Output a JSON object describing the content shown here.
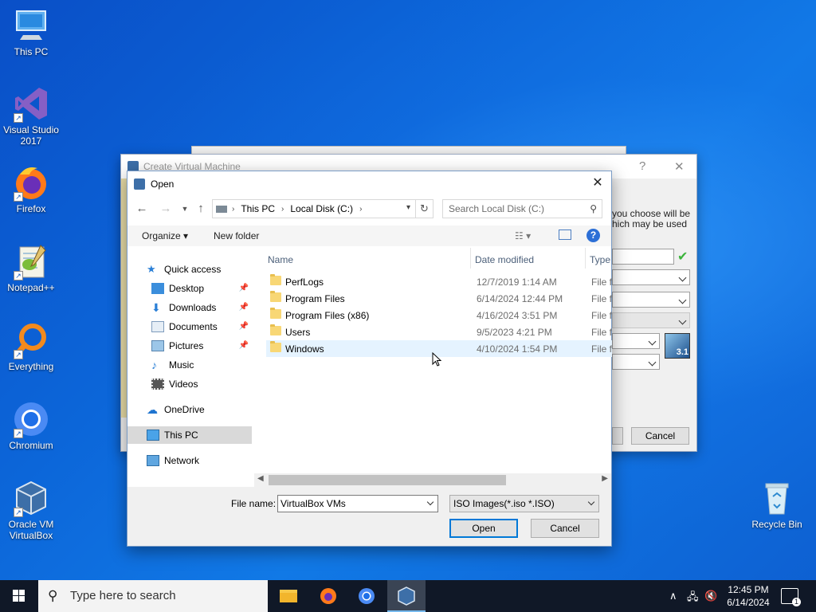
{
  "desktop": {
    "icons": [
      {
        "label": "This PC",
        "icon": "computer-icon"
      },
      {
        "label": "Visual Studio 2017",
        "icon": "visual-studio-icon"
      },
      {
        "label": "Firefox",
        "icon": "firefox-icon"
      },
      {
        "label": "Notepad++",
        "icon": "notepadpp-icon"
      },
      {
        "label": "Everything",
        "icon": "everything-icon"
      },
      {
        "label": "Chromium",
        "icon": "chromium-icon"
      },
      {
        "label": "Oracle VM VirtualBox",
        "icon": "virtualbox-icon"
      },
      {
        "label": "Recycle Bin",
        "icon": "recycle-bin-icon"
      }
    ]
  },
  "vbox_window": {
    "title": "Create Virtual Machine",
    "help_label": "?",
    "close_label": "✕",
    "side_text": "you choose will be hich may be used",
    "cancel_label": "Cancel",
    "version_badge": "3.1"
  },
  "dialog": {
    "title": "Open",
    "close_label": "✕",
    "breadcrumb": [
      "This PC",
      "Local Disk (C:)"
    ],
    "search_placeholder": "Search Local Disk (C:)",
    "toolbar": {
      "organize": "Organize",
      "new_folder": "New folder"
    },
    "nav": {
      "quick_access": "Quick access",
      "desktop": "Desktop",
      "downloads": "Downloads",
      "documents": "Documents",
      "pictures": "Pictures",
      "music": "Music",
      "videos": "Videos",
      "onedrive": "OneDrive",
      "this_pc": "This PC",
      "network": "Network"
    },
    "columns": {
      "name": "Name",
      "date": "Date modified",
      "type": "Type"
    },
    "files": [
      {
        "name": "PerfLogs",
        "date": "12/7/2019 1:14 AM",
        "type": "File fo"
      },
      {
        "name": "Program Files",
        "date": "6/14/2024 12:44 PM",
        "type": "File fo"
      },
      {
        "name": "Program Files (x86)",
        "date": "4/16/2024 3:51 PM",
        "type": "File fo"
      },
      {
        "name": "Users",
        "date": "9/5/2023 4:21 PM",
        "type": "File fo"
      },
      {
        "name": "Windows",
        "date": "4/10/2024 1:54 PM",
        "type": "File fo"
      }
    ],
    "file_name_label": "File name:",
    "file_name_value": "VirtualBox VMs",
    "filter_value": "ISO Images(*.iso *.ISO)",
    "open_label": "Open",
    "cancel_label": "Cancel"
  },
  "taskbar": {
    "search_placeholder": "Type here to search",
    "time": "12:45 PM",
    "date": "6/14/2024",
    "notification_count": "1"
  }
}
